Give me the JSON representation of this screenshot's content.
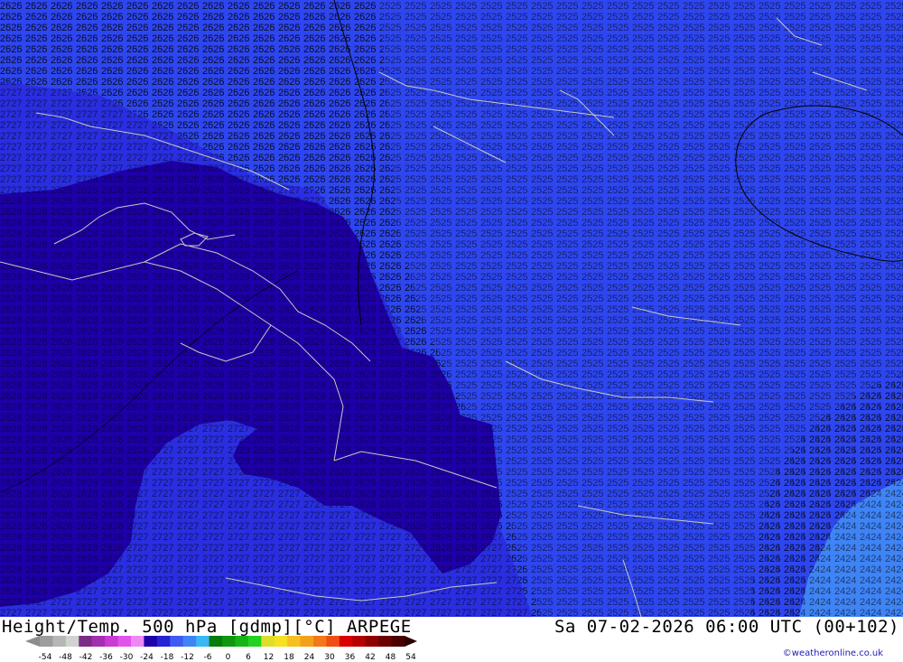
{
  "title_left": "Height/Temp. 500 hPa [gdmp][°C] ARPEGE",
  "title_right": "Sa 07-02-2026 06:00 UTC (00+102)",
  "credit": "©weatheronline.co.uk",
  "colors": {
    "band_28": "#1e00a8",
    "band_27": "#1e15c9",
    "band_26_25": "#2e46ef",
    "band_24": "#3f84f6",
    "coast": "#c8c8c8",
    "contour": "#000000"
  },
  "contour_labels": [
    "24",
    "25",
    "26",
    "27",
    "28"
  ],
  "legend": {
    "ticks": [
      "-54",
      "-48",
      "-42",
      "-36",
      "-30",
      "-24",
      "-18",
      "-12",
      "-6",
      "0",
      "6",
      "12",
      "18",
      "24",
      "30",
      "36",
      "42",
      "48",
      "54"
    ],
    "colors": [
      "#9d9d9d",
      "#b6b6b6",
      "#d2d2d2",
      "#7b2c86",
      "#a42fae",
      "#ca3bd4",
      "#e253ec",
      "#ee88f5",
      "#1e00a8",
      "#2424d4",
      "#3f5af2",
      "#3f84f6",
      "#38b8f4",
      "#0a7a0a",
      "#0f980f",
      "#16b416",
      "#22d222",
      "#dede2a",
      "#f5e022",
      "#f5c020",
      "#f5a01a",
      "#f27818",
      "#ee5014",
      "#d80000",
      "#b40000",
      "#8e0000",
      "#6a0000",
      "#4a0000"
    ]
  }
}
